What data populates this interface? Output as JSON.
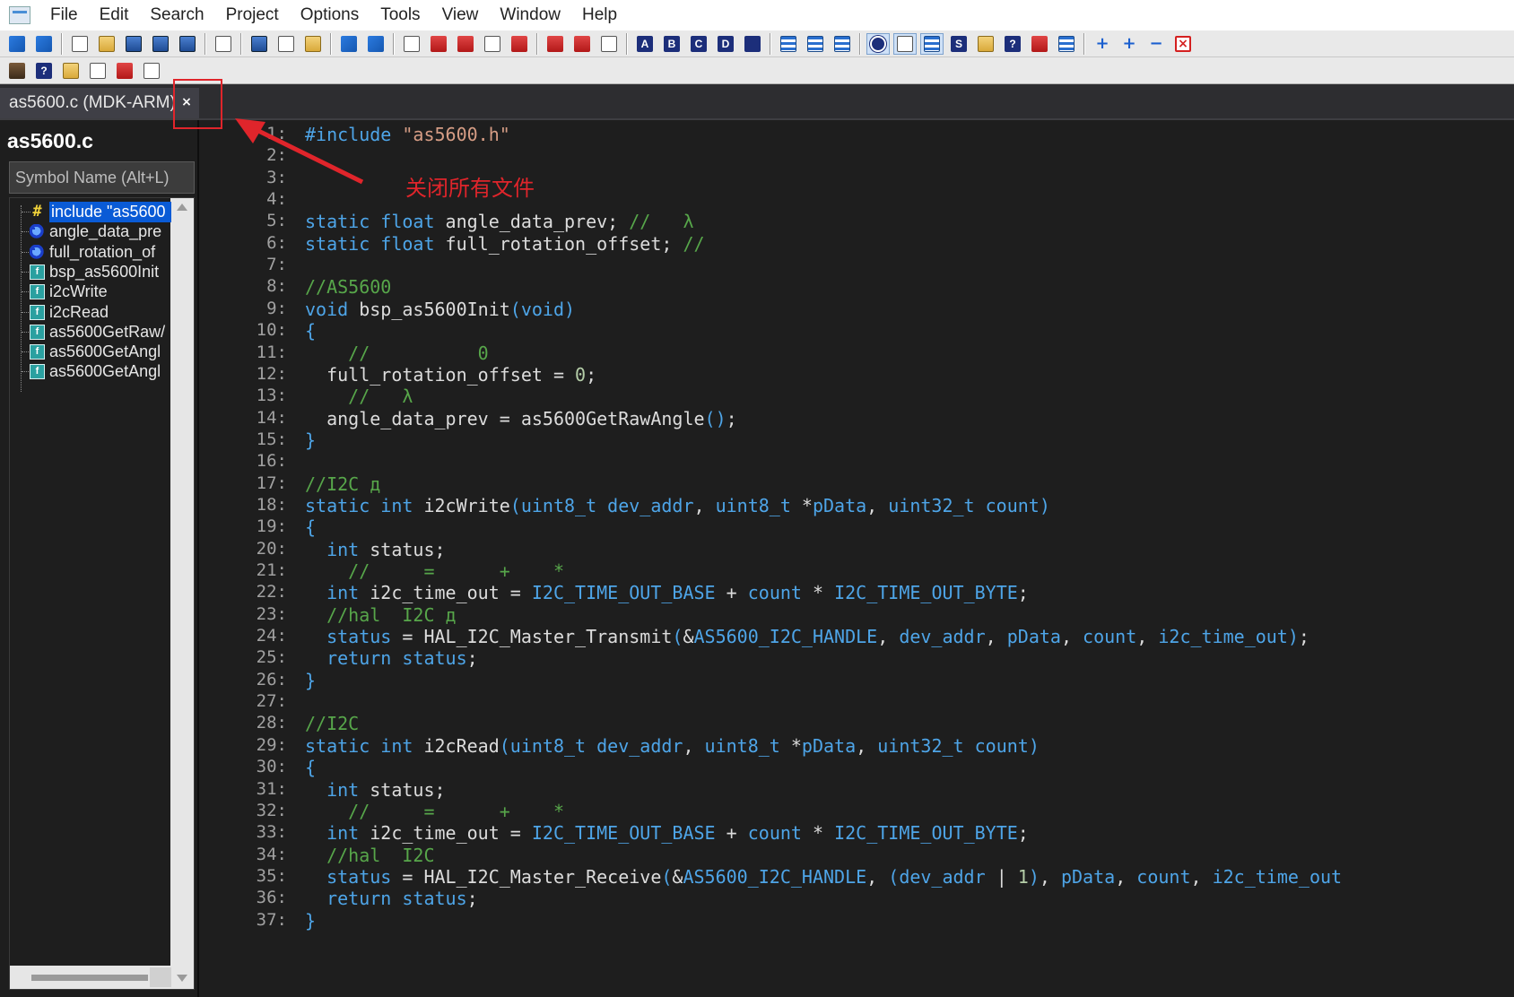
{
  "menu": [
    "File",
    "Edit",
    "Search",
    "Project",
    "Options",
    "Tools",
    "View",
    "Window",
    "Help"
  ],
  "tab": {
    "label": "as5600.c (MDK-ARM)",
    "close": "×"
  },
  "panel": {
    "title": "as5600.c",
    "search_placeholder": "Symbol Name (Alt+L)",
    "symbols": [
      {
        "icon": "hash-icon",
        "label": "include \"as5600",
        "selected": true
      },
      {
        "icon": "variable-icon",
        "label": "angle_data_pre"
      },
      {
        "icon": "variable-icon",
        "label": "full_rotation_of"
      },
      {
        "icon": "function-icon",
        "label": "bsp_as5600Init"
      },
      {
        "icon": "function-icon",
        "label": "i2cWrite"
      },
      {
        "icon": "function-icon",
        "label": "i2cRead"
      },
      {
        "icon": "function-icon",
        "label": "as5600GetRaw/"
      },
      {
        "icon": "function-icon",
        "label": "as5600GetAngl"
      },
      {
        "icon": "function-icon",
        "label": "as5600GetAngl"
      }
    ]
  },
  "annotation": {
    "text": "关闭所有文件",
    "color": "#e0252b"
  },
  "colors": {
    "keyword": "#4ea5e8",
    "comment": "#57a64a",
    "string": "#d69d85",
    "selection": "#0a5bd6"
  },
  "code_lines": [
    [
      [
        "pp",
        "#include "
      ],
      [
        "str",
        "\"as5600.h\""
      ]
    ],
    [],
    [],
    [],
    [
      [
        "kw",
        "static float "
      ],
      [
        "id",
        "angle_data_prev"
      ],
      [
        "op",
        "; "
      ],
      [
        "cm",
        "//   λ"
      ]
    ],
    [
      [
        "kw",
        "static float "
      ],
      [
        "id",
        "full_rotation_offset"
      ],
      [
        "op",
        "; "
      ],
      [
        "cm",
        "//"
      ]
    ],
    [],
    [
      [
        "cm",
        "//AS5600"
      ]
    ],
    [
      [
        "kw",
        "void "
      ],
      [
        "id",
        "bsp_as5600Init"
      ],
      [
        "kw",
        "(void)"
      ]
    ],
    [
      [
        "kw",
        "{"
      ]
    ],
    [
      [
        "cm",
        "    //          0"
      ]
    ],
    [
      [
        "id",
        "  full_rotation_offset "
      ],
      [
        "op",
        "= "
      ],
      [
        "num",
        "0"
      ],
      [
        "op",
        ";"
      ]
    ],
    [
      [
        "cm",
        "    //   λ"
      ]
    ],
    [
      [
        "id",
        "  angle_data_prev "
      ],
      [
        "op",
        "= "
      ],
      [
        "id",
        "as5600GetRawAngle"
      ],
      [
        "kw",
        "()"
      ],
      [
        "op",
        ";"
      ]
    ],
    [
      [
        "kw",
        "}"
      ]
    ],
    [],
    [
      [
        "cm",
        "//I2C д"
      ]
    ],
    [
      [
        "kw",
        "static int "
      ],
      [
        "id",
        "i2cWrite"
      ],
      [
        "kw",
        "(uint8_t "
      ],
      [
        "mac",
        "dev_addr"
      ],
      [
        "op",
        ", "
      ],
      [
        "kw",
        "uint8_t "
      ],
      [
        "op",
        "*"
      ],
      [
        "mac",
        "pData"
      ],
      [
        "op",
        ", "
      ],
      [
        "kw",
        "uint32_t "
      ],
      [
        "mac",
        "count"
      ],
      [
        "kw",
        ")"
      ]
    ],
    [
      [
        "kw",
        "{"
      ]
    ],
    [
      [
        "kw",
        "  int "
      ],
      [
        "id",
        "status"
      ],
      [
        "op",
        ";"
      ]
    ],
    [
      [
        "cm",
        "    //     =      +    *"
      ]
    ],
    [
      [
        "kw",
        "  int "
      ],
      [
        "id",
        "i2c_time_out "
      ],
      [
        "op",
        "= "
      ],
      [
        "mac",
        "I2C_TIME_OUT_BASE "
      ],
      [
        "op",
        "+ "
      ],
      [
        "mac",
        "count "
      ],
      [
        "op",
        "* "
      ],
      [
        "mac",
        "I2C_TIME_OUT_BYTE"
      ],
      [
        "op",
        ";"
      ]
    ],
    [
      [
        "cm",
        "  //hal  I2C д"
      ]
    ],
    [
      [
        "mac",
        "  status "
      ],
      [
        "op",
        "= "
      ],
      [
        "id",
        "HAL_I2C_Master_Transmit"
      ],
      [
        "kw",
        "("
      ],
      [
        "op",
        "&"
      ],
      [
        "mac",
        "AS5600_I2C_HANDLE"
      ],
      [
        "op",
        ", "
      ],
      [
        "mac",
        "dev_addr"
      ],
      [
        "op",
        ", "
      ],
      [
        "mac",
        "pData"
      ],
      [
        "op",
        ", "
      ],
      [
        "mac",
        "count"
      ],
      [
        "op",
        ", "
      ],
      [
        "mac",
        "i2c_time_out"
      ],
      [
        "kw",
        ")"
      ],
      [
        "op",
        ";"
      ]
    ],
    [
      [
        "kw",
        "  return "
      ],
      [
        "mac",
        "status"
      ],
      [
        "op",
        ";"
      ]
    ],
    [
      [
        "kw",
        "}"
      ]
    ],
    [],
    [
      [
        "cm",
        "//I2C"
      ]
    ],
    [
      [
        "kw",
        "static int "
      ],
      [
        "id",
        "i2cRead"
      ],
      [
        "kw",
        "(uint8_t "
      ],
      [
        "mac",
        "dev_addr"
      ],
      [
        "op",
        ", "
      ],
      [
        "kw",
        "uint8_t "
      ],
      [
        "op",
        "*"
      ],
      [
        "mac",
        "pData"
      ],
      [
        "op",
        ", "
      ],
      [
        "kw",
        "uint32_t "
      ],
      [
        "mac",
        "count"
      ],
      [
        "kw",
        ")"
      ]
    ],
    [
      [
        "kw",
        "{"
      ]
    ],
    [
      [
        "kw",
        "  int "
      ],
      [
        "id",
        "status"
      ],
      [
        "op",
        ";"
      ]
    ],
    [
      [
        "cm",
        "    //     =      +    *"
      ]
    ],
    [
      [
        "kw",
        "  int "
      ],
      [
        "id",
        "i2c_time_out "
      ],
      [
        "op",
        "= "
      ],
      [
        "mac",
        "I2C_TIME_OUT_BASE "
      ],
      [
        "op",
        "+ "
      ],
      [
        "mac",
        "count "
      ],
      [
        "op",
        "* "
      ],
      [
        "mac",
        "I2C_TIME_OUT_BYTE"
      ],
      [
        "op",
        ";"
      ]
    ],
    [
      [
        "cm",
        "  //hal  I2C"
      ]
    ],
    [
      [
        "mac",
        "  status "
      ],
      [
        "op",
        "= "
      ],
      [
        "id",
        "HAL_I2C_Master_Receive"
      ],
      [
        "kw",
        "("
      ],
      [
        "op",
        "&"
      ],
      [
        "mac",
        "AS5600_I2C_HANDLE"
      ],
      [
        "op",
        ", "
      ],
      [
        "kw",
        "("
      ],
      [
        "mac",
        "dev_addr "
      ],
      [
        "op",
        "| "
      ],
      [
        "num",
        "1"
      ],
      [
        "kw",
        ")"
      ],
      [
        "op",
        ", "
      ],
      [
        "mac",
        "pData"
      ],
      [
        "op",
        ", "
      ],
      [
        "mac",
        "count"
      ],
      [
        "op",
        ", "
      ],
      [
        "mac",
        "i2c_time_out"
      ]
    ],
    [
      [
        "kw",
        "  return "
      ],
      [
        "mac",
        "status"
      ],
      [
        "op",
        ";"
      ]
    ],
    [
      [
        "kw",
        "}"
      ]
    ]
  ]
}
